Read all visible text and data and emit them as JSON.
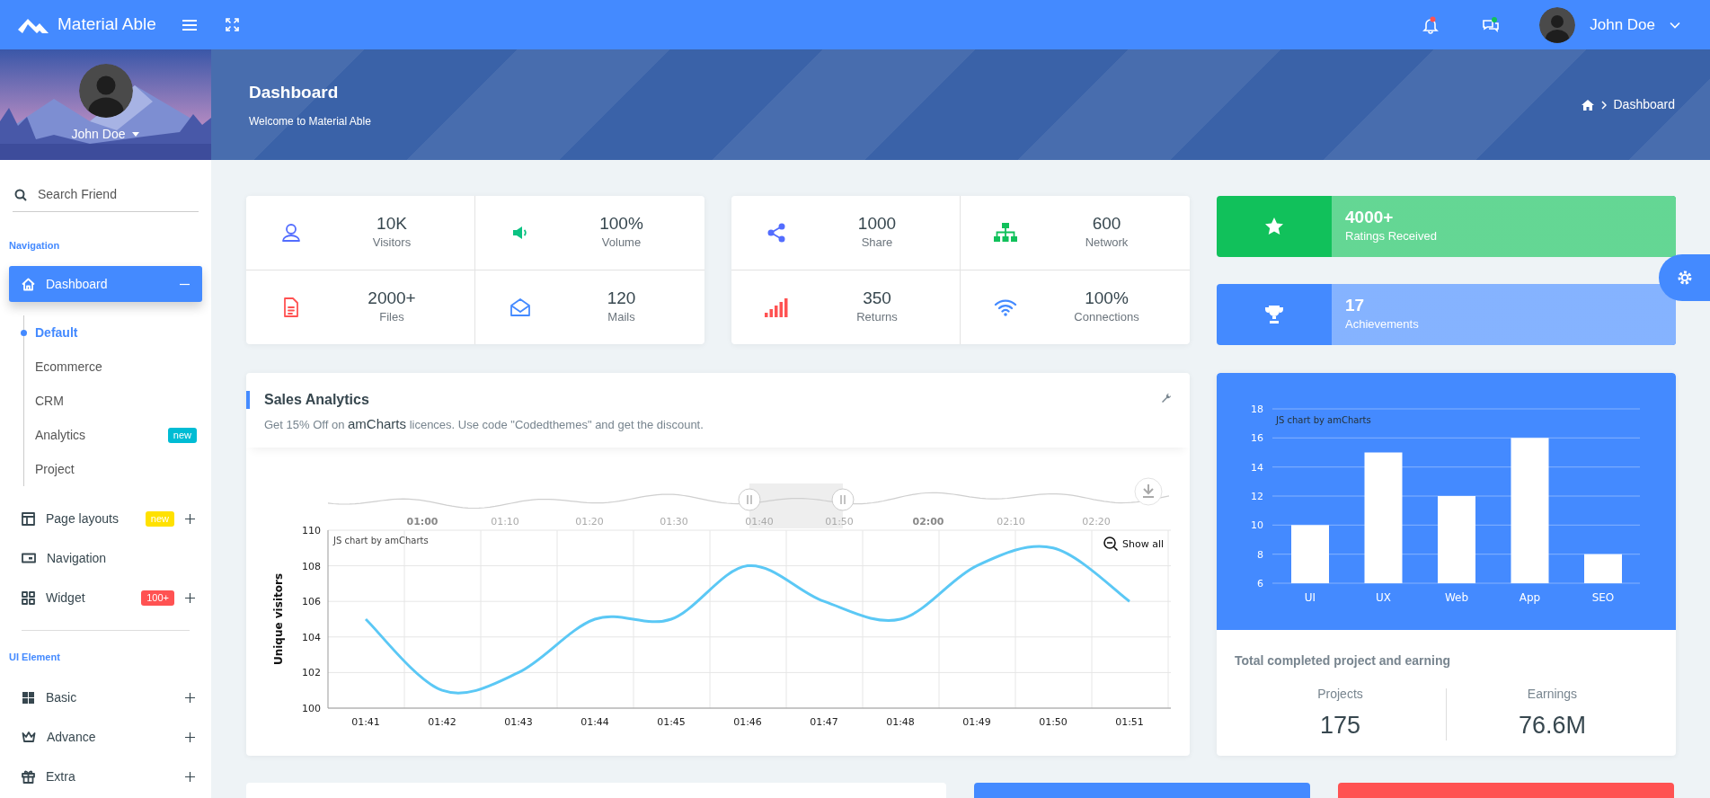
{
  "topbar": {
    "brand": "Material Able",
    "user": "John Doe"
  },
  "sidebar": {
    "user": "John Doe",
    "search": {
      "placeholder": "Search Friend"
    },
    "sections": [
      {
        "label": "Navigation",
        "items": [
          {
            "label": "Dashboard",
            "selected": true,
            "expanded": true,
            "children": [
              {
                "label": "Default",
                "selected": true
              },
              {
                "label": "Ecommerce",
                "selected": false
              },
              {
                "label": "CRM",
                "selected": false
              },
              {
                "label": "Analytics",
                "selected": false,
                "badge": {
                  "text": "new",
                  "color": "#00bcd4"
                }
              },
              {
                "label": "Project",
                "selected": false
              }
            ]
          },
          {
            "label": "Page layouts",
            "selected": false,
            "expanded": false,
            "badge": {
              "text": "new",
              "color": "#ffe100"
            }
          },
          {
            "label": "Navigation",
            "selected": false
          },
          {
            "label": "Widget",
            "selected": false,
            "expanded": false,
            "badge": {
              "text": "100+",
              "color": "#ff5252"
            }
          }
        ]
      },
      {
        "label": "UI Element",
        "items": [
          {
            "label": "Basic",
            "selected": false,
            "expanded": false
          },
          {
            "label": "Advance",
            "selected": false,
            "expanded": false
          },
          {
            "label": "Extra",
            "selected": false,
            "expanded": false
          }
        ]
      }
    ]
  },
  "banner": {
    "title": "Dashboard",
    "subtitle": "Welcome to Material Able",
    "breadcrumb": "Dashboard"
  },
  "stats": [
    {
      "tiles": [
        {
          "value": "10K",
          "label": "Visitors",
          "color": "#536dfe"
        },
        {
          "value": "100%",
          "label": "Volume",
          "color": "#0ac282"
        },
        {
          "value": "2000+",
          "label": "Files",
          "color": "#ff5252"
        },
        {
          "value": "120",
          "label": "Mails",
          "color": "#448aff"
        }
      ]
    },
    {
      "tiles": [
        {
          "value": "1000",
          "label": "Share",
          "color": "#536dfe"
        },
        {
          "value": "600",
          "label": "Network",
          "color": "#11c15b"
        },
        {
          "value": "350",
          "label": "Returns",
          "color": "#ff5252"
        },
        {
          "value": "100%",
          "label": "Connections",
          "color": "#448aff"
        }
      ]
    }
  ],
  "highlights": [
    {
      "value": "4000+",
      "label": "Ratings Received",
      "color": "#11c15b"
    },
    {
      "value": "17",
      "label": "Achievements",
      "color": "#448aff"
    }
  ],
  "sales": {
    "title": "Sales Analytics",
    "note": {
      "before": "Get 15% Off on",
      "link": "amCharts",
      "after": "licences. Use code \"Codedthemes\" and get the discount."
    },
    "credit": "JS chart by amCharts",
    "zoom_button": "Show all",
    "navigator_labels": [
      {
        "label": "01:00",
        "major": true
      },
      {
        "label": "01:10",
        "major": false
      },
      {
        "label": "01:20",
        "major": false
      },
      {
        "label": "01:30",
        "major": false
      },
      {
        "label": "01:40",
        "major": false
      },
      {
        "label": "01:50",
        "major": false
      },
      {
        "label": "02:00",
        "major": true
      },
      {
        "label": "02:10",
        "major": false
      },
      {
        "label": "02:20",
        "major": false
      }
    ],
    "chart_data": {
      "type": "line",
      "ylabel": "Unique visitors",
      "categories": [
        "01:41",
        "01:42",
        "01:43",
        "01:44",
        "01:45",
        "01:46",
        "01:47",
        "01:48",
        "01:49",
        "01:50",
        "01:51"
      ],
      "series": [
        {
          "color": "#5bc8f5",
          "values": [
            105,
            101,
            102,
            105,
            105,
            108,
            106,
            105,
            108,
            109,
            106
          ]
        }
      ],
      "ylim": [
        100,
        110
      ],
      "yticks": [
        100,
        102,
        104,
        106,
        108,
        110
      ],
      "grid": true
    }
  },
  "projects": {
    "credit": "JS chart by amCharts",
    "chart_data": {
      "type": "bar",
      "categories": [
        "UI",
        "UX",
        "Web",
        "App",
        "SEO"
      ],
      "series": [
        {
          "color": "#ffffff",
          "values": [
            10,
            15,
            12,
            16,
            8
          ]
        }
      ],
      "ylim": [
        6,
        18
      ],
      "yticks": [
        6,
        8,
        10,
        12,
        14,
        16,
        18
      ],
      "grid": true
    },
    "summary": {
      "title": "Total completed project and earning",
      "metrics": [
        {
          "label": "Projects",
          "value": "175"
        },
        {
          "label": "Earnings",
          "value": "76.6M"
        }
      ]
    }
  },
  "bottom_cards": [
    {
      "color": "#ffffff"
    },
    {
      "color": "#448aff"
    },
    {
      "color": "#ff5252"
    }
  ]
}
